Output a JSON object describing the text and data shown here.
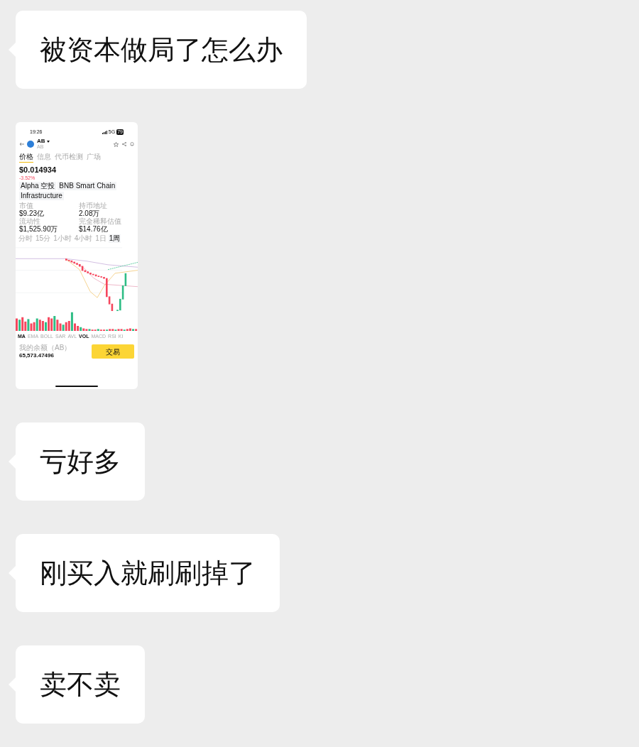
{
  "messages": [
    {
      "kind": "text",
      "text": "被资本做局了怎么办"
    },
    {
      "kind": "image",
      "screenshot": {
        "status_time": "19:26",
        "network": "5G",
        "battery": "79",
        "token": "AB",
        "token_sub": "AB",
        "tabs": [
          {
            "label": "价格",
            "selected": true
          },
          {
            "label": "信息",
            "selected": false
          },
          {
            "label": "代币检测",
            "selected": false
          },
          {
            "label": "广场",
            "selected": false
          }
        ],
        "price": "$0.014934",
        "change": "-3.52%",
        "tags": [
          "Alpha 空投",
          "BNB Smart Chain",
          "Infrastructure"
        ],
        "stats": [
          {
            "label": "市值",
            "value": "$9.23亿"
          },
          {
            "label": "持币地址",
            "value": "2.08万"
          },
          {
            "label": "流动性",
            "value": "$1,525.90万"
          },
          {
            "label": "完全稀释估值",
            "value": "$14.76亿"
          }
        ],
        "timeframes": [
          {
            "label": "分时",
            "selected": false
          },
          {
            "label": "15分",
            "selected": false
          },
          {
            "label": "1小时",
            "selected": false
          },
          {
            "label": "4小时",
            "selected": false
          },
          {
            "label": "1日",
            "selected": false
          },
          {
            "label": "1周",
            "selected": true
          }
        ],
        "indicators": [
          {
            "label": "MA",
            "selected": true
          },
          {
            "label": "EMA",
            "selected": false
          },
          {
            "label": "BOLL",
            "selected": false
          },
          {
            "label": "SAR",
            "selected": false
          },
          {
            "label": "AVL",
            "selected": false
          },
          {
            "label": "VOL",
            "selected": true
          },
          {
            "label": "MACD",
            "selected": false
          },
          {
            "label": "RSI",
            "selected": false
          },
          {
            "label": "KI",
            "selected": false
          }
        ],
        "balance_label": "我的余额（AB）",
        "balance": "65,573.47496",
        "trade_button": "交易"
      }
    },
    {
      "kind": "text",
      "text": "亏好多"
    },
    {
      "kind": "text",
      "text": "刚买入就刷刷掉了"
    },
    {
      "kind": "text",
      "text": "卖不卖"
    }
  ]
}
